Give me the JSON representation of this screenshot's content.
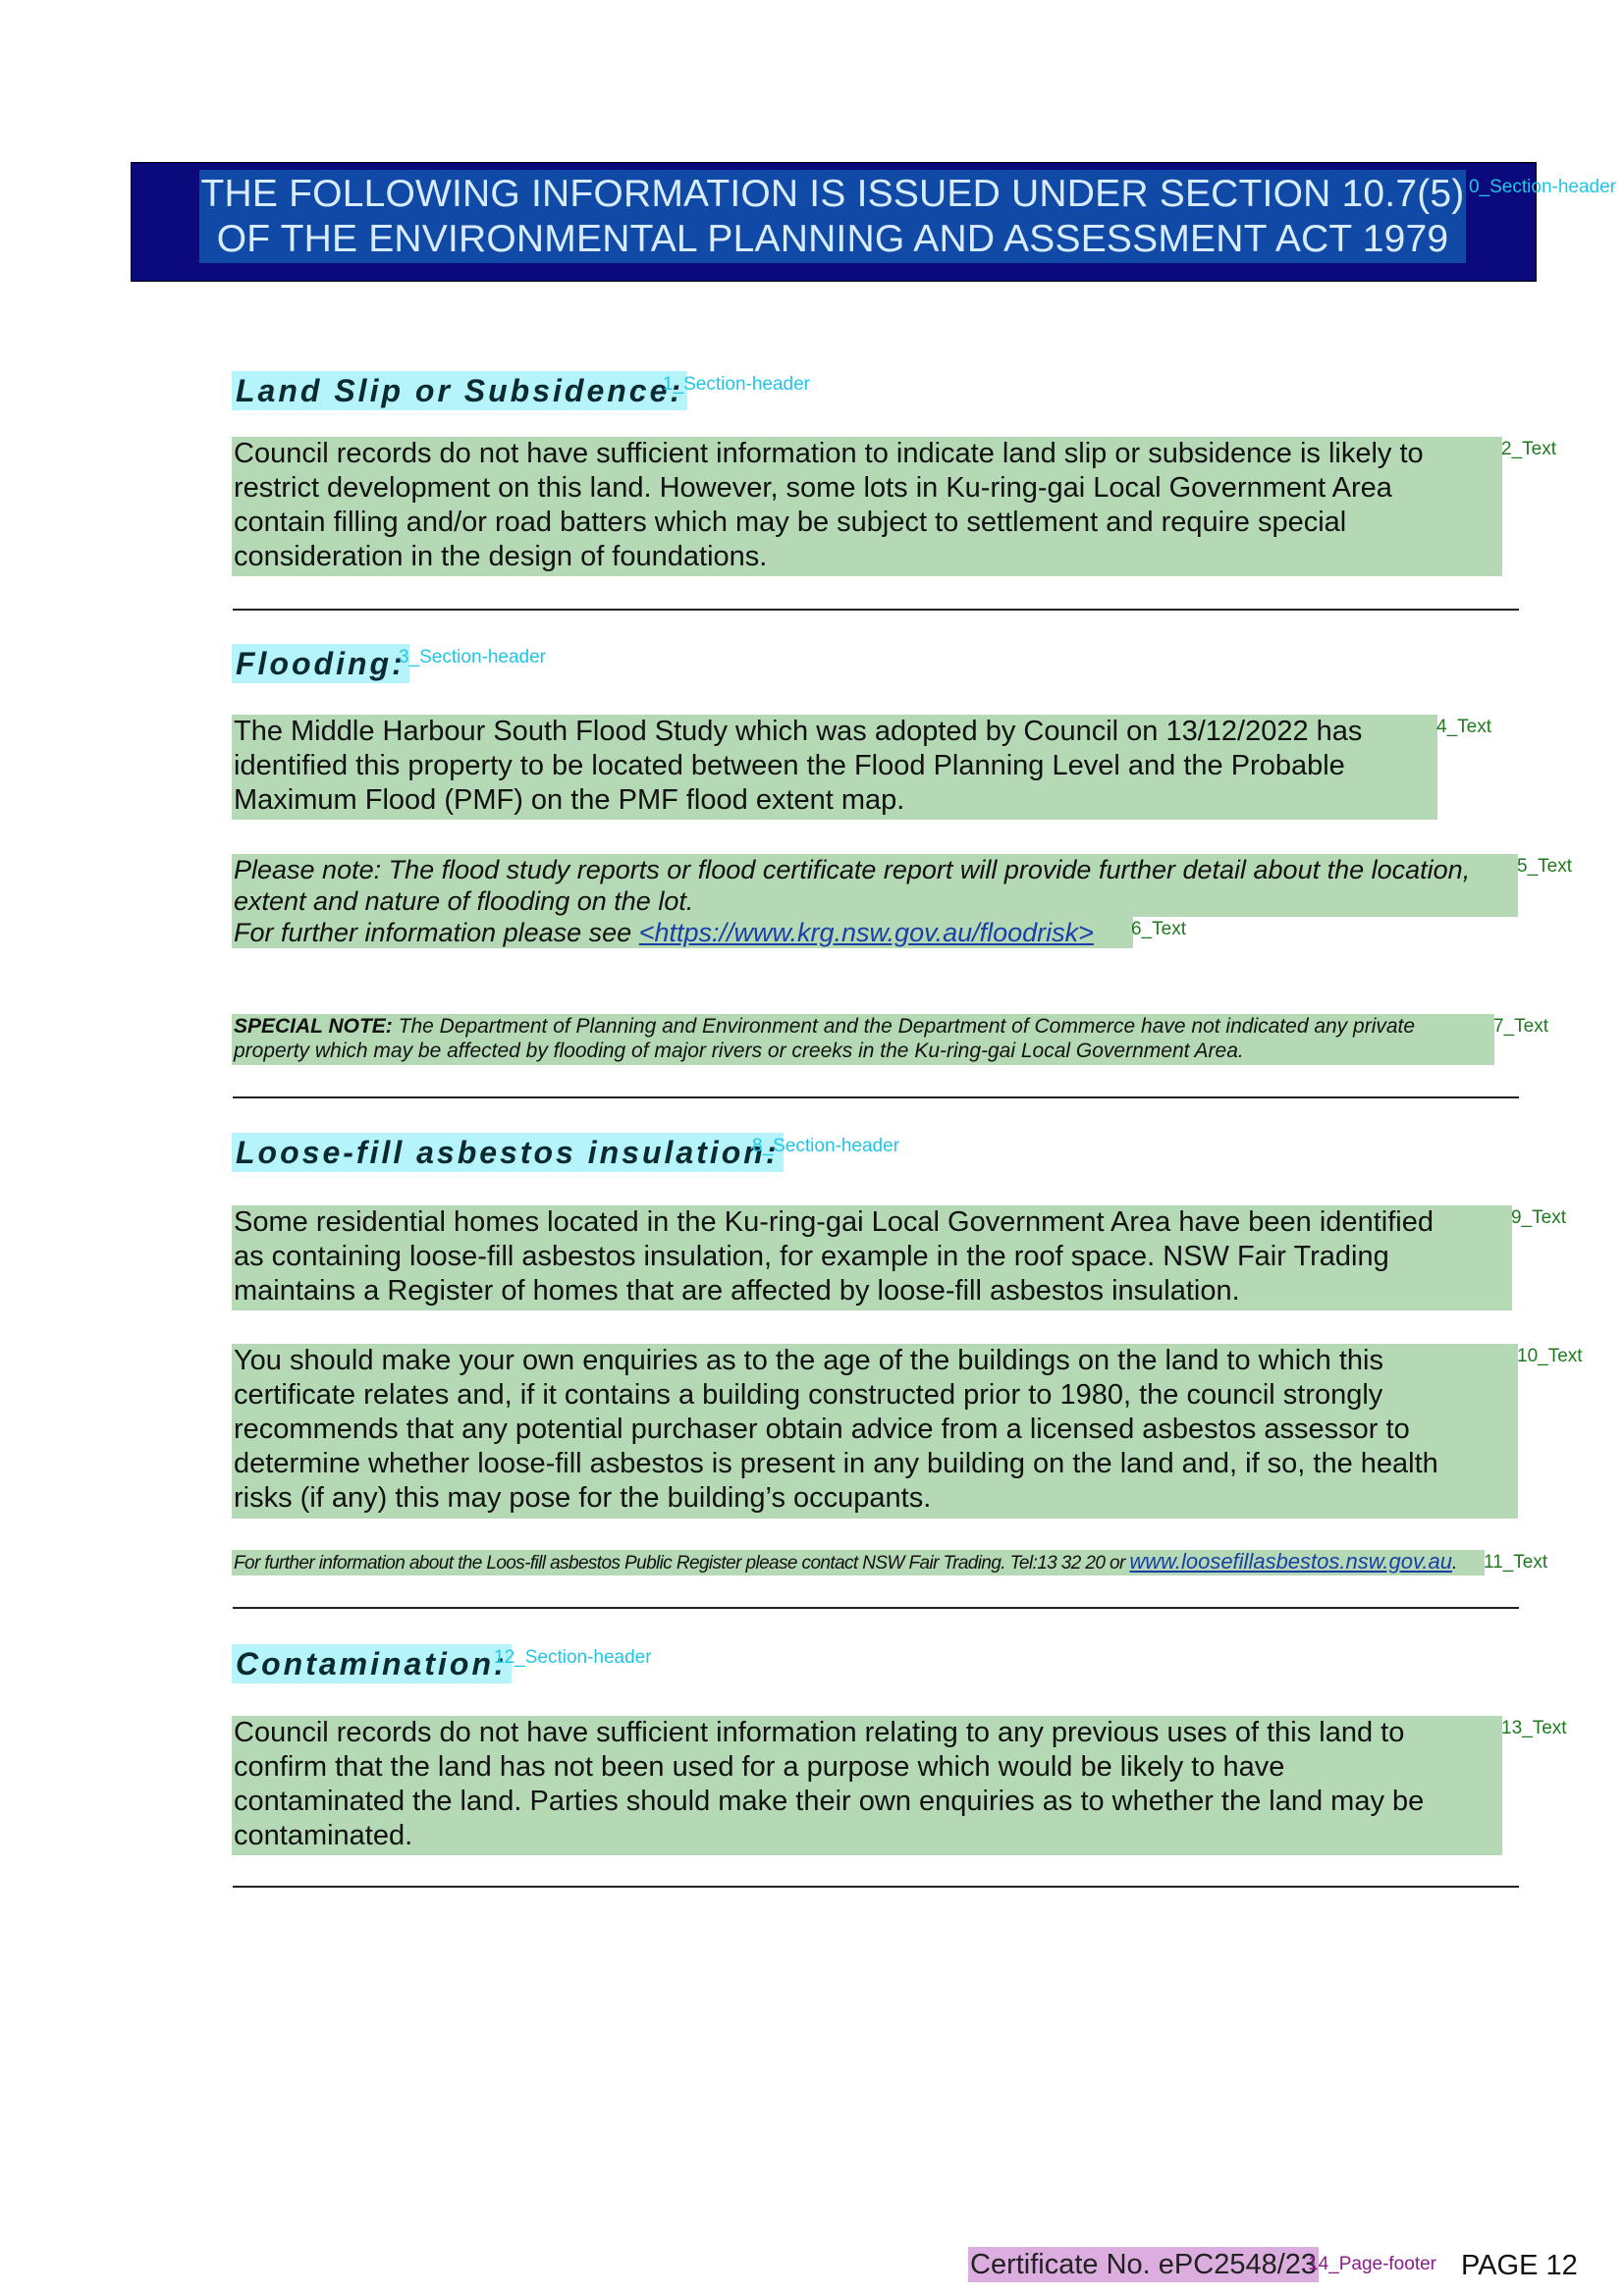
{
  "banner": {
    "line1": "THE FOLLOWING INFORMATION IS ISSUED UNDER SECTION 10.7(5)",
    "line2": "OF THE ENVIRONMENTAL PLANNING AND ASSESSMENT ACT 1979",
    "tag": "0_Section-header"
  },
  "land_slip": {
    "header": "Land Slip or Subsidence:",
    "header_tag": "1_Section-header",
    "text_lines": [
      "Council records do not have sufficient information to indicate land slip or subsidence is likely to",
      "restrict development on this land. However, some lots in Ku-ring-gai Local Government Area",
      "contain filling and/or road batters which may be subject to settlement and require special",
      "consideration in the design of foundations."
    ],
    "text_tag": "2_Text"
  },
  "flooding": {
    "header": "Flooding:",
    "header_tag": "3_Section-header",
    "text_lines": [
      "The Middle Harbour South Flood Study which was adopted by Council on 13/12/2022 has",
      "identified this property to be located between the Flood Planning Level and the Probable",
      "Maximum Flood (PMF) on the PMF flood extent map."
    ],
    "text_tag": "4_Text",
    "note_lines": [
      "Please note: The flood study reports or flood certificate report will provide further detail about the location,",
      "extent and nature of flooding on the lot."
    ],
    "note_tag": "5_Text",
    "further_prefix": "For further information please see ",
    "further_link": "<https://www.krg.nsw.gov.au/floodrisk>",
    "further_tag": "6_Text",
    "special_label": "SPECIAL NOTE:",
    "special_line1": " The Department of Planning and Environment and the Department of Commerce have not indicated any private",
    "special_line2": "property which may be affected by flooding of major rivers or creeks in the Ku-ring-gai Local Government Area.",
    "special_tag": "7_Text"
  },
  "asbestos": {
    "header": "Loose-fill asbestos insulation:",
    "header_tag": "8_Section-header",
    "p1_lines": [
      "Some residential homes located in the Ku-ring-gai Local Government Area have been identified",
      "as containing loose-fill asbestos insulation, for example in the roof space. NSW Fair Trading",
      "maintains a Register of homes that are affected by loose-fill asbestos insulation."
    ],
    "p1_tag": "9_Text",
    "p2_lines": [
      "You should make your own enquiries as to the age of the buildings on the land to which this",
      "certificate relates and, if it contains a building constructed prior to 1980, the council strongly",
      "recommends that any potential purchaser obtain advice from a licensed asbestos assessor to",
      "determine whether loose-fill asbestos is present in any building on the land and, if so, the health",
      "risks (if any) this may pose for the building’s occupants."
    ],
    "p2_tag": "10_Text",
    "small_prefix": "For further information about the Loos-fill asbestos Public Register please contact NSW Fair Trading. Tel:13 32 20 or ",
    "small_link": "www.loosefillasbestos.nsw.gov.au",
    "small_suffix": ".",
    "small_tag": "11_Text"
  },
  "contamination": {
    "header": "Contamination:",
    "header_tag": "12_Section-header",
    "text_lines": [
      "Council records do not have sufficient information relating to any previous uses of this land to",
      "confirm that the land has not been used for a purpose which would be likely to have",
      "contaminated the land. Parties should make their own enquiries as to whether the land may be",
      "contaminated."
    ],
    "text_tag": "13_Text"
  },
  "footer": {
    "certificate": "Certificate No. ePC2548/23",
    "tag": "14_Page-footer",
    "page": "PAGE 12"
  }
}
